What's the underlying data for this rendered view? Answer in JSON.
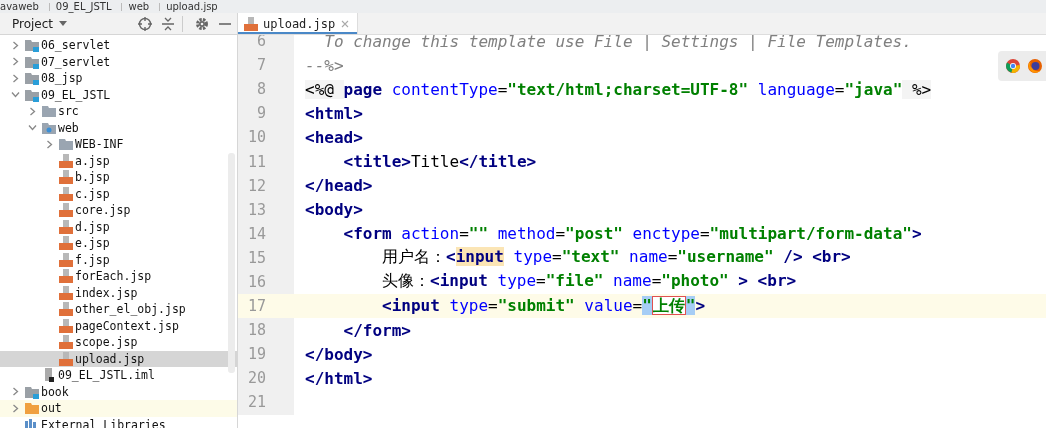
{
  "breadcrumb": [
    "avaweb",
    "09_EL_JSTL",
    "web",
    "upload.jsp"
  ],
  "project_panel": {
    "title": "Project",
    "tree": [
      {
        "label": "06_servlet",
        "kind": "module",
        "expanded": false,
        "selected": false
      },
      {
        "label": "07_servlet",
        "kind": "module",
        "expanded": false,
        "selected": false
      },
      {
        "label": "08_jsp",
        "kind": "module",
        "expanded": false,
        "selected": false
      },
      {
        "label": "09_EL_JSTL",
        "kind": "module",
        "expanded": true,
        "selected": false,
        "children": [
          {
            "label": "src",
            "kind": "folder",
            "expanded": false,
            "selected": false
          },
          {
            "label": "web",
            "kind": "webfolder",
            "expanded": true,
            "selected": false,
            "children": [
              {
                "label": "WEB-INF",
                "kind": "folder",
                "expanded": false,
                "selected": false
              },
              {
                "label": "a.jsp",
                "kind": "jsp",
                "selected": false
              },
              {
                "label": "b.jsp",
                "kind": "jsp",
                "selected": false
              },
              {
                "label": "c.jsp",
                "kind": "jsp",
                "selected": false
              },
              {
                "label": "core.jsp",
                "kind": "jsp",
                "selected": false
              },
              {
                "label": "d.jsp",
                "kind": "jsp",
                "selected": false
              },
              {
                "label": "e.jsp",
                "kind": "jsp",
                "selected": false
              },
              {
                "label": "f.jsp",
                "kind": "jsp",
                "selected": false
              },
              {
                "label": "forEach.jsp",
                "kind": "jsp",
                "selected": false
              },
              {
                "label": "index.jsp",
                "kind": "jsp",
                "selected": false
              },
              {
                "label": "other_el_obj.jsp",
                "kind": "jsp",
                "selected": false
              },
              {
                "label": "pageContext.jsp",
                "kind": "jsp",
                "selected": false
              },
              {
                "label": "scope.jsp",
                "kind": "jsp",
                "selected": false
              },
              {
                "label": "upload.jsp",
                "kind": "jsp",
                "selected": true
              }
            ]
          },
          {
            "label": "09_EL_JSTL.iml",
            "kind": "iml",
            "selected": false
          }
        ]
      },
      {
        "label": "book",
        "kind": "module",
        "expanded": false,
        "selected": false
      },
      {
        "label": "out",
        "kind": "outfolder",
        "expanded": false,
        "selected": false
      },
      {
        "label": "External Libraries",
        "kind": "library",
        "selected": false
      }
    ]
  },
  "editor": {
    "tabs": [
      {
        "label": "upload.jsp",
        "selected": true
      }
    ],
    "lines": [
      {
        "number": "6",
        "current": false,
        "segments": [
          {
            "kind": "comment",
            "text": "  To change this template use File | Settings | File Templates."
          }
        ]
      },
      {
        "number": "7",
        "current": false,
        "segments": [
          {
            "kind": "comment",
            "text": "--%>"
          }
        ]
      },
      {
        "number": "8",
        "current": false,
        "segments": [
          {
            "kind": "directive",
            "text": "<%@ "
          },
          {
            "kind": "tag",
            "text": "page "
          },
          {
            "kind": "attr",
            "text": "contentType"
          },
          {
            "kind": "text",
            "text": "="
          },
          {
            "kind": "value",
            "text": "\"text/html;charset=UTF-8\""
          },
          {
            "kind": "attr",
            "text": " language"
          },
          {
            "kind": "text",
            "text": "="
          },
          {
            "kind": "value",
            "text": "\"java\""
          },
          {
            "kind": "directive",
            "text": " %>"
          }
        ]
      },
      {
        "number": "9",
        "current": false,
        "segments": [
          {
            "kind": "tag",
            "text": "<html>"
          }
        ]
      },
      {
        "number": "10",
        "current": false,
        "segments": [
          {
            "kind": "tag",
            "text": "<head>"
          }
        ]
      },
      {
        "number": "11",
        "current": false,
        "segments": [
          {
            "kind": "tag",
            "text": "    <title>"
          },
          {
            "kind": "text",
            "text": "Title"
          },
          {
            "kind": "tag",
            "text": "</title>"
          }
        ]
      },
      {
        "number": "12",
        "current": false,
        "segments": [
          {
            "kind": "tag",
            "text": "</head>"
          }
        ]
      },
      {
        "number": "13",
        "current": false,
        "segments": [
          {
            "kind": "tag",
            "text": "<body>"
          }
        ]
      },
      {
        "number": "14",
        "current": false,
        "segments": [
          {
            "kind": "tag",
            "text": "    <form "
          },
          {
            "kind": "attr",
            "text": "action"
          },
          {
            "kind": "text",
            "text": "="
          },
          {
            "kind": "value",
            "text": "\"\""
          },
          {
            "kind": "attr",
            "text": " method"
          },
          {
            "kind": "text",
            "text": "="
          },
          {
            "kind": "value",
            "text": "\"post\""
          },
          {
            "kind": "attr",
            "text": " enctype"
          },
          {
            "kind": "text",
            "text": "="
          },
          {
            "kind": "value",
            "text": "\"multipart/form-data\""
          },
          {
            "kind": "tag",
            "text": ">"
          }
        ]
      },
      {
        "number": "15",
        "current": false,
        "segments": [
          {
            "kind": "text",
            "text": "        用户名："
          },
          {
            "kind": "tag",
            "text": "<"
          },
          {
            "kind": "match",
            "text": "input"
          },
          {
            "kind": "attr",
            "text": " type"
          },
          {
            "kind": "text",
            "text": "="
          },
          {
            "kind": "value",
            "text": "\"text\""
          },
          {
            "kind": "attr",
            "text": " name"
          },
          {
            "kind": "text",
            "text": "="
          },
          {
            "kind": "value",
            "text": "\"username\""
          },
          {
            "kind": "tag",
            "text": " /> <br>"
          }
        ]
      },
      {
        "number": "16",
        "current": false,
        "segments": [
          {
            "kind": "text",
            "text": "        头像："
          },
          {
            "kind": "tag",
            "text": "<input "
          },
          {
            "kind": "attr",
            "text": "type"
          },
          {
            "kind": "text",
            "text": "="
          },
          {
            "kind": "value",
            "text": "\"file\""
          },
          {
            "kind": "attr",
            "text": " name"
          },
          {
            "kind": "text",
            "text": "="
          },
          {
            "kind": "value",
            "text": "\"photo\""
          },
          {
            "kind": "tag",
            "text": " > <br>"
          }
        ]
      },
      {
        "number": "17",
        "current": true,
        "segments": [
          {
            "kind": "tag",
            "text": "        <input "
          },
          {
            "kind": "attr",
            "text": "type"
          },
          {
            "kind": "text",
            "text": "="
          },
          {
            "kind": "value",
            "text": "\"submit\""
          },
          {
            "kind": "attr",
            "text": " value"
          },
          {
            "kind": "text",
            "text": "="
          },
          {
            "kind": "selvalue",
            "text": "\""
          },
          {
            "kind": "boxed",
            "text": "上传"
          },
          {
            "kind": "selvalue",
            "text": "\""
          },
          {
            "kind": "tag",
            "text": ">"
          }
        ]
      },
      {
        "number": "18",
        "current": false,
        "segments": [
          {
            "kind": "tag",
            "text": "    </form>"
          }
        ]
      },
      {
        "number": "19",
        "current": false,
        "segments": [
          {
            "kind": "tag",
            "text": "</body>"
          }
        ]
      },
      {
        "number": "20",
        "current": false,
        "segments": [
          {
            "kind": "tag",
            "text": "</html>"
          }
        ]
      },
      {
        "number": "21",
        "current": false
      }
    ]
  }
}
